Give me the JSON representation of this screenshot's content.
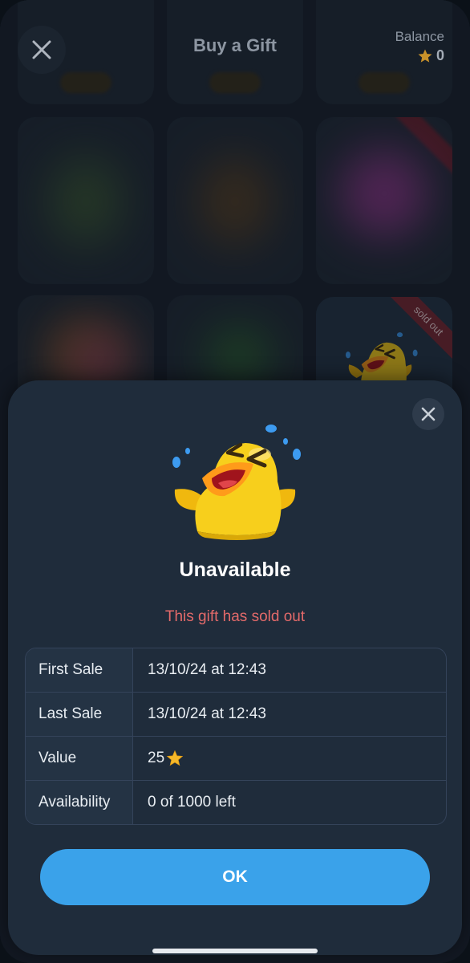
{
  "header": {
    "title": "Buy a Gift",
    "balance_label": "Balance",
    "balance_value": "0",
    "close_icon": "close-icon",
    "star_icon": "star-icon"
  },
  "store": {
    "sold_out_ribbon": "sold out"
  },
  "sheet": {
    "title": "Unavailable",
    "subtitle": "This gift has sold out",
    "rows": [
      {
        "label": "First Sale",
        "value": "13/10/24 at 12:43"
      },
      {
        "label": "Last Sale",
        "value": "13/10/24 at 12:43"
      },
      {
        "label": "Value",
        "value": "25",
        "icon": "star-icon"
      },
      {
        "label": "Availability",
        "value": "0 of 1000 left"
      }
    ],
    "ok_label": "OK"
  },
  "colors": {
    "accent": "#3aa2ea",
    "error_text": "#e46a6a",
    "sheet_bg": "#1f2c3b",
    "star": "#f5b829",
    "duck_yellow": "#f7cf1c"
  }
}
